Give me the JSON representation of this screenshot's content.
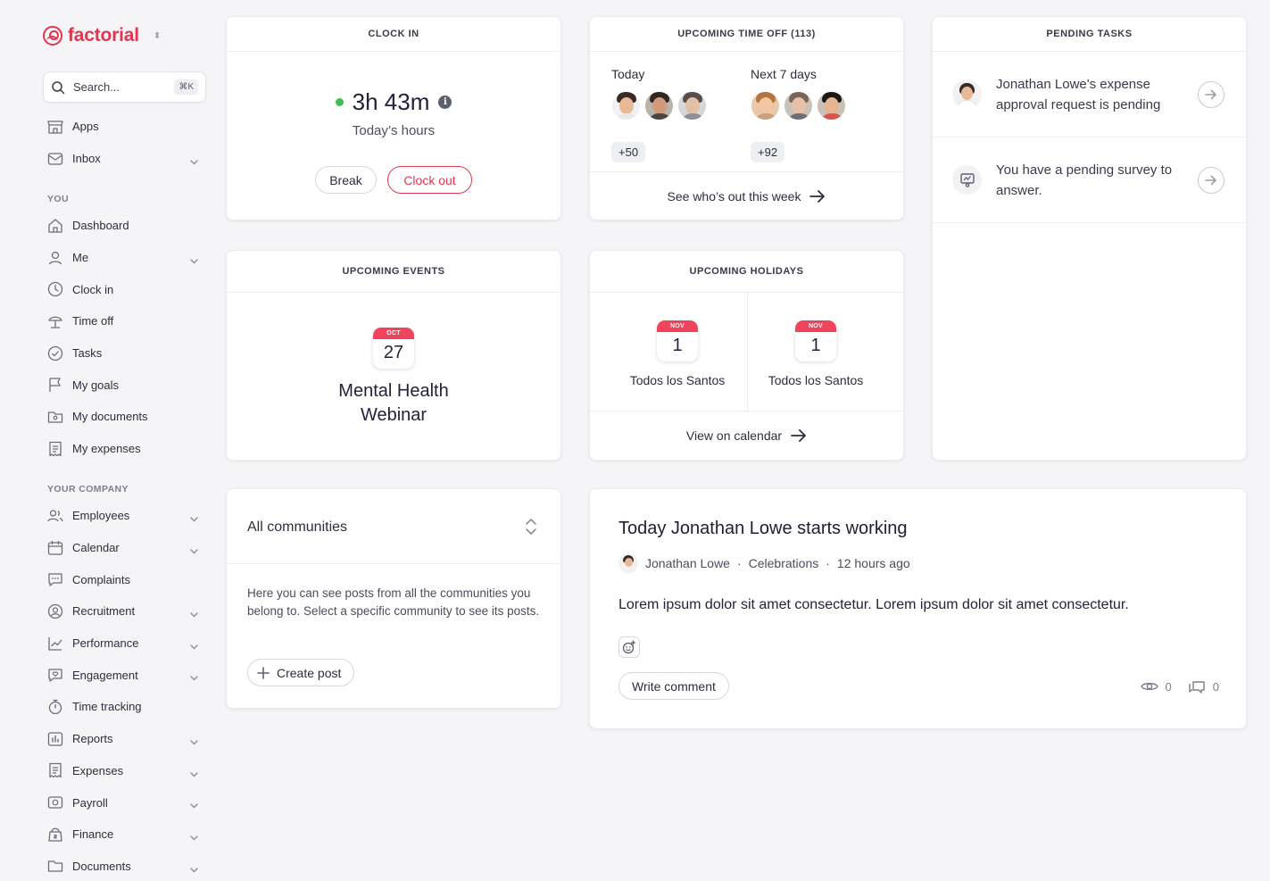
{
  "brand": {
    "name": "factorial",
    "accent": "#e0374f"
  },
  "search": {
    "placeholder": "Search...",
    "shortcut": "⌘K"
  },
  "nav_top": [
    {
      "label": "Apps",
      "icon": "store-icon",
      "chevron": false
    },
    {
      "label": "Inbox",
      "icon": "inbox-icon",
      "chevron": true
    }
  ],
  "sections": {
    "you": "YOU",
    "company": "YOUR COMPANY"
  },
  "nav_you": [
    {
      "label": "Dashboard",
      "icon": "home-icon",
      "chevron": false
    },
    {
      "label": "Me",
      "icon": "user-icon",
      "chevron": true
    },
    {
      "label": "Clock in",
      "icon": "clock-icon",
      "chevron": false
    },
    {
      "label": "Time off",
      "icon": "beach-icon",
      "chevron": false
    },
    {
      "label": "Tasks",
      "icon": "check-circle-icon",
      "chevron": false
    },
    {
      "label": "My goals",
      "icon": "flag-icon",
      "chevron": false
    },
    {
      "label": "My documents",
      "icon": "folder-user-icon",
      "chevron": false
    },
    {
      "label": "My expenses",
      "icon": "receipt-icon",
      "chevron": false
    }
  ],
  "nav_company": [
    {
      "label": "Employees",
      "icon": "users-icon",
      "chevron": true
    },
    {
      "label": "Calendar",
      "icon": "calendar-icon",
      "chevron": true
    },
    {
      "label": "Complaints",
      "icon": "chat-icon",
      "chevron": false
    },
    {
      "label": "Recruitment",
      "icon": "recruit-icon",
      "chevron": true
    },
    {
      "label": "Performance",
      "icon": "chart-icon",
      "chevron": true
    },
    {
      "label": "Engagement",
      "icon": "heart-chat-icon",
      "chevron": true
    },
    {
      "label": "Time tracking",
      "icon": "stopwatch-icon",
      "chevron": false
    },
    {
      "label": "Reports",
      "icon": "report-icon",
      "chevron": true
    },
    {
      "label": "Expenses",
      "icon": "receipt-icon",
      "chevron": true
    },
    {
      "label": "Payroll",
      "icon": "money-icon",
      "chevron": true
    },
    {
      "label": "Finance",
      "icon": "bag-icon",
      "chevron": true
    },
    {
      "label": "Documents",
      "icon": "folder-icon",
      "chevron": true
    }
  ],
  "clock_in": {
    "title": "CLOCK IN",
    "time": "3h 43m",
    "subtitle": "Today’s hours",
    "break_label": "Break",
    "clock_out_label": "Clock out",
    "status_color": "#3fbe59"
  },
  "time_off": {
    "title": "UPCOMING TIME OFF (113)",
    "today_label": "Today",
    "today_more": "+50",
    "next_label": "Next 7 days",
    "next_more": "+92",
    "link": "See who’s out this week"
  },
  "pending_tasks": {
    "title": "PENDING TASKS",
    "items": [
      {
        "text": "Jonathan Lowe's expense approval request is pending",
        "icon": "avatar"
      },
      {
        "text": "You have a pending survey to answer.",
        "icon": "survey-icon"
      }
    ]
  },
  "events": {
    "title": "UPCOMING EVENTS",
    "month": "OCT",
    "day": "27",
    "name": "Mental Health Webinar"
  },
  "holidays": {
    "title": "UPCOMING HOLIDAYS",
    "items": [
      {
        "month": "NOV",
        "day": "1",
        "name": "Todos los Santos"
      },
      {
        "month": "NOV",
        "day": "1",
        "name": "Todos los Santos"
      }
    ],
    "link": "View on calendar"
  },
  "communities": {
    "selector": "All communities",
    "description": "Here you can see posts from all the communities you belong to. Select a specific community to see its posts.",
    "create_label": "Create post"
  },
  "post": {
    "title": "Today Jonathan Lowe starts working",
    "author": "Jonathan Lowe",
    "category": "Celebrations",
    "time": "12 hours ago",
    "body": "Lorem ipsum dolor sit amet consectetur. Lorem ipsum dolor sit amet consectetur.",
    "comment_label": "Write comment",
    "views": "0",
    "comments": "0"
  }
}
